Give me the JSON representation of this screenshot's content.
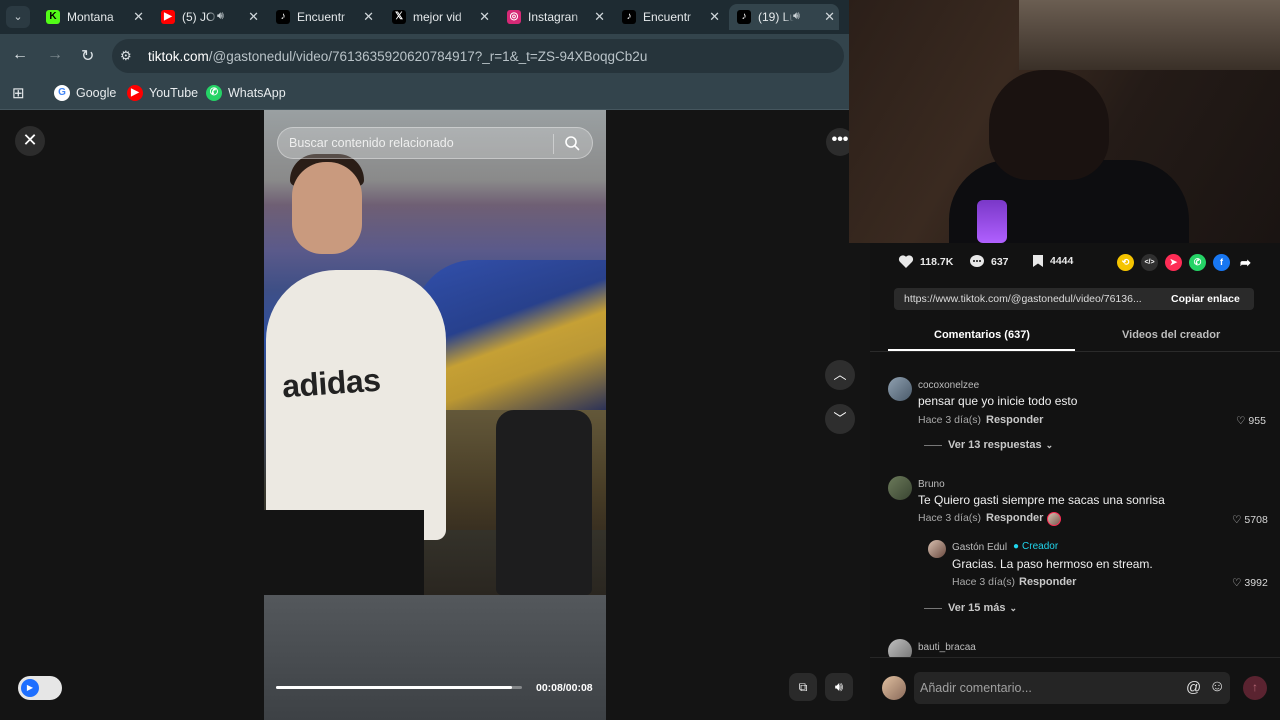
{
  "browser": {
    "tabs": [
      {
        "title": "Montana",
        "favicon": "kick-icon",
        "color": "#53fc18",
        "letter": "K",
        "active": false,
        "audio": false
      },
      {
        "title": "(5) JO",
        "favicon": "youtube-icon",
        "color": "#ff0000",
        "letter": "▶",
        "active": false,
        "audio": true
      },
      {
        "title": "Encuentr",
        "favicon": "tiktok-icon",
        "color": "#000000",
        "letter": "♪",
        "active": false,
        "audio": false
      },
      {
        "title": "mejor vid",
        "favicon": "x-icon",
        "color": "#000000",
        "letter": "𝕏",
        "active": false,
        "audio": false
      },
      {
        "title": "Instagran",
        "favicon": "instagram-icon",
        "color": "#d62976",
        "letter": "◎",
        "active": false,
        "audio": false
      },
      {
        "title": "Encuentr",
        "favicon": "tiktok-icon",
        "color": "#000000",
        "letter": "♪",
        "active": false,
        "audio": false
      },
      {
        "title": "(19) Lu",
        "favicon": "tiktok-icon",
        "color": "#000000",
        "letter": "♪",
        "active": true,
        "audio": true
      }
    ],
    "url_host": "tiktok.com",
    "url_rest": "/@gastonedul/video/7613635920620784917?_r=1&_t=ZS-94XBoqgCb2u",
    "bookmarks": [
      {
        "label": "Google",
        "icon": "google-icon",
        "color": "#ffffff",
        "letter": "G"
      },
      {
        "label": "YouTube",
        "icon": "youtube-icon",
        "color": "#ff0000",
        "letter": "▶"
      },
      {
        "label": "WhatsApp",
        "icon": "whatsapp-icon",
        "color": "#25d366",
        "letter": "✆"
      }
    ]
  },
  "player": {
    "search_placeholder": "Buscar contenido relacionado",
    "shirt_brand": "adidas",
    "time": "00:08/00:08",
    "progress": 0.96
  },
  "stats": {
    "likes": "118.7K",
    "comments": "637",
    "saves": "4444"
  },
  "share_icons": [
    {
      "name": "repost-icon",
      "color": "#f5c400",
      "glyph": "⟲"
    },
    {
      "name": "embed-icon",
      "color": "#2f2f2f",
      "glyph": "</>"
    },
    {
      "name": "send-icon",
      "color": "#fe2c55",
      "glyph": "➤"
    },
    {
      "name": "whatsapp-share-icon",
      "color": "#25d366",
      "glyph": "✆"
    },
    {
      "name": "facebook-share-icon",
      "color": "#1877f2",
      "glyph": "f"
    },
    {
      "name": "share-more-icon",
      "color": "#121212",
      "glyph": "➦"
    }
  ],
  "copy_link": {
    "url": "https://www.tiktok.com/@gastonedul/video/76136...",
    "button": "Copiar enlace"
  },
  "panel_tabs": {
    "comments": "Comentarios (637)",
    "creator_videos": "Videos del creador"
  },
  "comments": [
    {
      "user": "cocoxonelzee",
      "text": "pensar que yo inicie todo esto",
      "time": "Hace 3 día(s)",
      "reply": "Responder",
      "likes": "955",
      "more": "Ver 13 respuestas"
    },
    {
      "user": "Bruno",
      "text": "Te Quiero gasti siempre me sacas una sonrisa",
      "time": "Hace 3 día(s)",
      "reply": "Responder",
      "likes": "5708",
      "sub": {
        "user": "Gastón Edul",
        "badge": "Creador",
        "text": "Gracias. La paso hermoso en stream.",
        "time": "Hace 3 día(s)",
        "reply": "Responder",
        "likes": "3992"
      },
      "more": "Ver 15 más"
    },
    {
      "user": "bauti_bracaa"
    }
  ],
  "comment_bar": {
    "placeholder": "Añadir comentario..."
  }
}
